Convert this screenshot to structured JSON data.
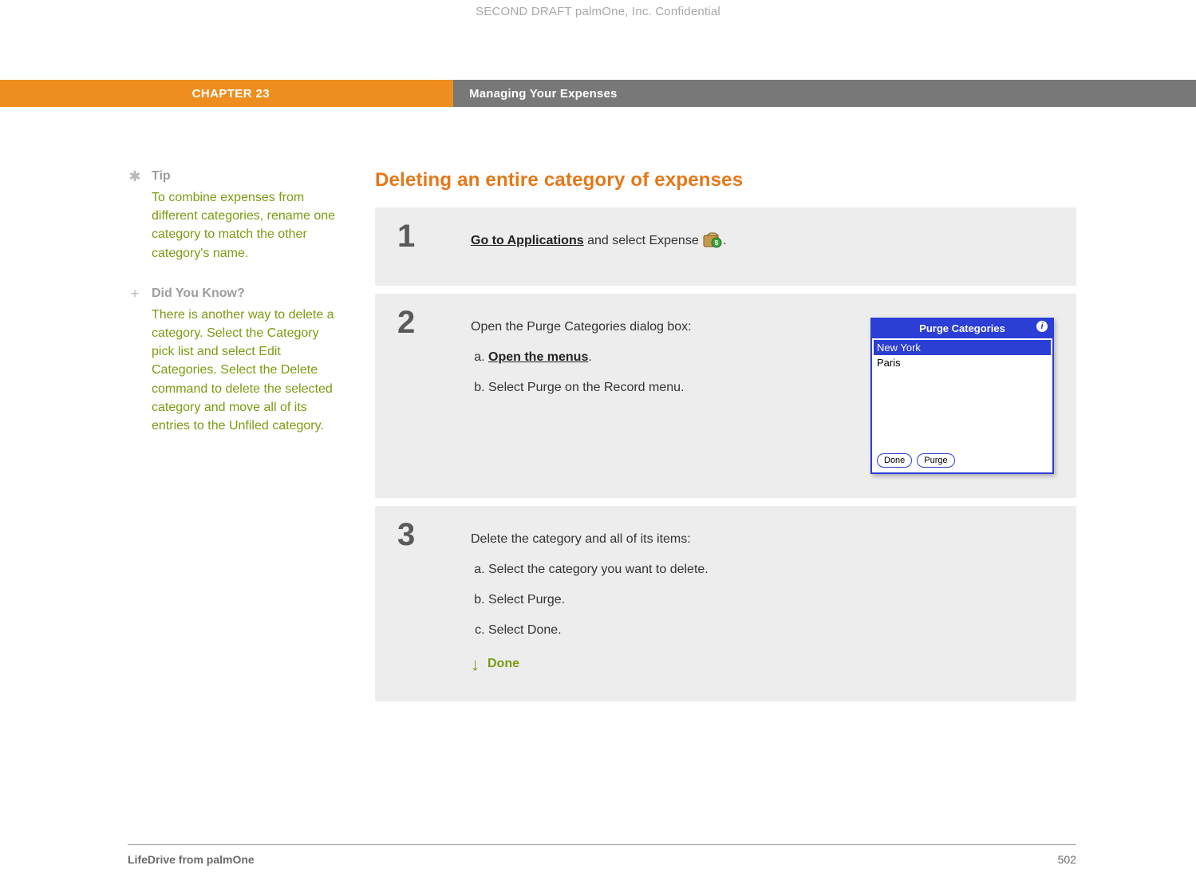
{
  "draft_header": "SECOND DRAFT palmOne, Inc.  Confidential",
  "banner": {
    "chapter": "CHAPTER 23",
    "title": "Managing Your Expenses"
  },
  "sidebar": {
    "tip": {
      "marker": "✱",
      "label": "Tip",
      "body": "To combine expenses from different categories, rename one category to match the other category's name."
    },
    "didyouknow": {
      "marker": "+",
      "label": "Did You Know?",
      "body": "There is another way to delete a category. Select the Category pick list and select Edit Categories. Select the Delete command to delete the selected category and move all of its entries to the Unfiled category."
    }
  },
  "section_title": "Deleting an entire category of expenses",
  "steps": {
    "s1": {
      "num": "1",
      "link": "Go to Applications",
      "rest": " and select Expense ",
      "period": "."
    },
    "s2": {
      "num": "2",
      "intro": "Open the Purge Categories dialog box:",
      "a_link": "Open the menus",
      "a_after": ".",
      "b": "Select Purge on the Record menu."
    },
    "s3": {
      "num": "3",
      "intro": "Delete the category and all of its items:",
      "a": "Select the category you want to delete.",
      "b": "Select Purge.",
      "c": "Select Done.",
      "done": "Done"
    }
  },
  "palm": {
    "title": "Purge Categories",
    "info": "i",
    "items": {
      "i0": "New York",
      "i1": "Paris"
    },
    "btn_done": "Done",
    "btn_purge": "Purge"
  },
  "footer": {
    "product": "LifeDrive from palmOne",
    "page": "502"
  }
}
